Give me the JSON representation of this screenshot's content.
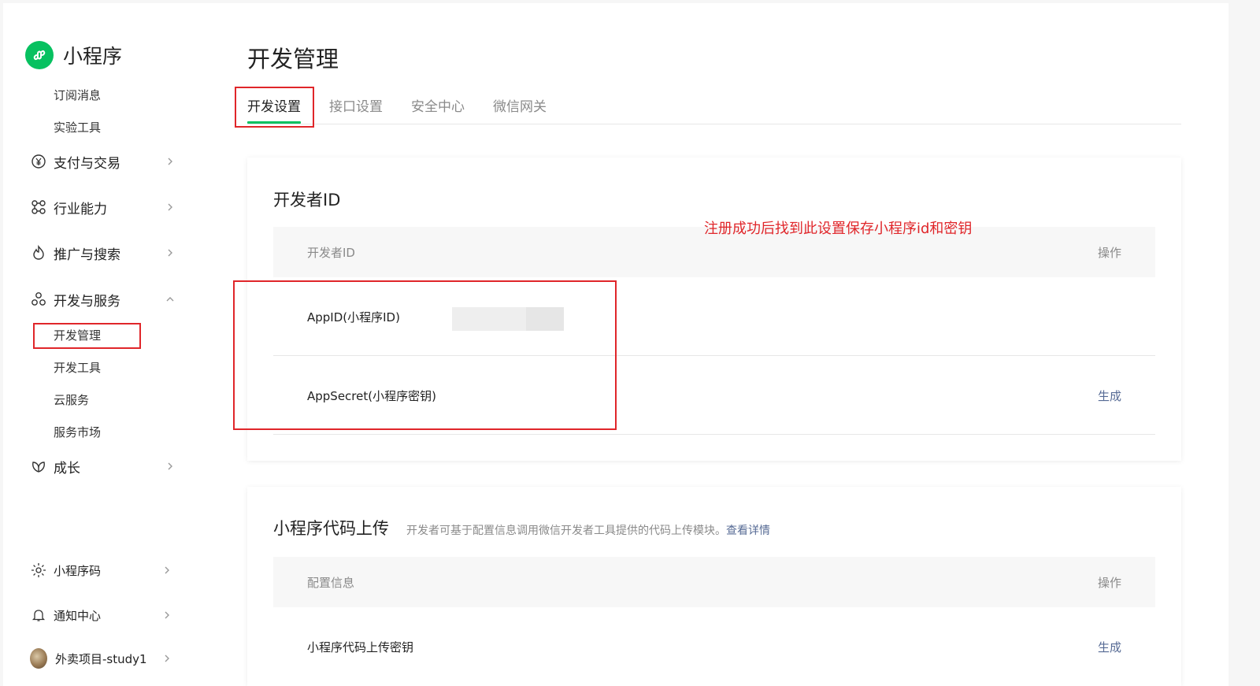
{
  "sidebar": {
    "brand": "小程序",
    "sub_top": [
      "订阅消息",
      "实验工具"
    ],
    "nav": [
      {
        "label": "支付与交易",
        "icon": "yen-circle-icon"
      },
      {
        "label": "行业能力",
        "icon": "molecule-icon"
      },
      {
        "label": "推广与搜索",
        "icon": "flame-icon"
      },
      {
        "label": "开发与服务",
        "icon": "cluster-icon",
        "expanded": true
      }
    ],
    "dev_sub": [
      "开发管理",
      "开发工具",
      "云服务",
      "服务市场"
    ],
    "growth": {
      "label": "成长",
      "icon": "leaf-icon"
    },
    "bottom": [
      {
        "label": "小程序码",
        "icon": "sun-code-icon"
      },
      {
        "label": "通知中心",
        "icon": "bell-icon"
      },
      {
        "label": "外卖项目-study1",
        "icon": "avatar"
      }
    ]
  },
  "main": {
    "title": "开发管理",
    "tabs": [
      "开发设置",
      "接口设置",
      "安全中心",
      "微信网关"
    ],
    "active_tab": 0
  },
  "developer_id": {
    "title": "开发者ID",
    "head_left": "开发者ID",
    "head_right": "操作",
    "rows": [
      {
        "label": "AppID(小程序ID)",
        "action": ""
      },
      {
        "label": "AppSecret(小程序密钥)",
        "action": "生成"
      }
    ]
  },
  "code_upload": {
    "title": "小程序代码上传",
    "desc": "开发者可基于配置信息调用微信开发者工具提供的代码上传模块。",
    "desc_link": "查看详情",
    "head_left": "配置信息",
    "head_right": "操作",
    "rows": [
      {
        "label": "小程序代码上传密钥",
        "action": "生成"
      }
    ]
  },
  "annotation": {
    "text": "注册成功后找到此设置保存小程序id和密钥",
    "color": "#e0262a"
  },
  "colors": {
    "brand_green": "#07c160",
    "link_blue": "#576b95"
  }
}
